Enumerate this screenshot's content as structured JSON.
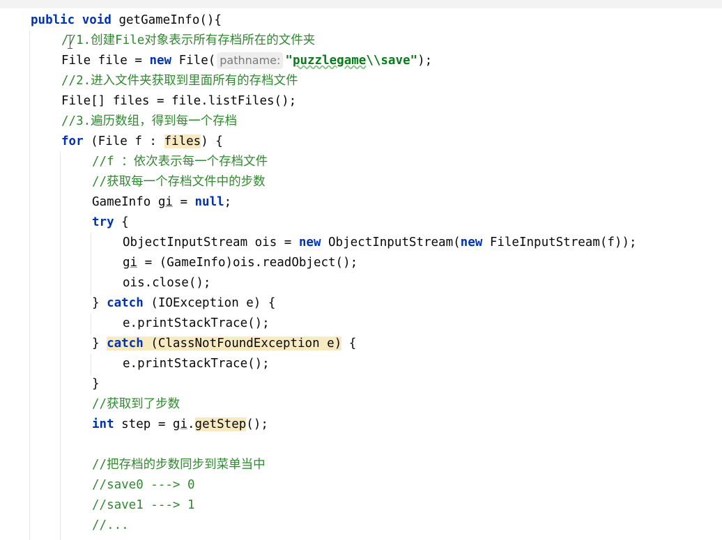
{
  "code": {
    "l1": {
      "kw1": "public",
      "kw2": "void",
      "rest": " getGameInfo(){"
    },
    "l2": {
      "comment": "//1.创建File对象表示所有存档所在的文件夹"
    },
    "l3": {
      "a": "File file = ",
      "kw": "new",
      "b": " File(",
      "hint": "pathname:",
      "str_open": "\"",
      "str_word": "puzzlegame",
      "str_rest": "\\\\save\"",
      "c": ");"
    },
    "l4": {
      "comment": "//2.进入文件夹获取到里面所有的存档文件"
    },
    "l5": {
      "text": "File[] files = file.listFiles();"
    },
    "l6": {
      "comment": "//3.遍历数组，得到每一个存档"
    },
    "l7": {
      "kw": "for",
      "a": " (File f : ",
      "hl": "files",
      "b": ") {"
    },
    "l8": {
      "comment": "//f ：依次表示每一个存档文件"
    },
    "l9": {
      "comment": "//获取每一个存档文件中的步数"
    },
    "l10": {
      "a": "GameInfo ",
      "var": "gi",
      "b": " = ",
      "kw": "null",
      "c": ";"
    },
    "l11": {
      "kw": "try",
      "a": " {"
    },
    "l12": {
      "a": "ObjectInputStream ois = ",
      "kw1": "new",
      "b": " ObjectInputStream(",
      "kw2": "new",
      "c": " FileInputStream(f));"
    },
    "l13": {
      "var": "gi",
      "a": " = (GameInfo)ois.readObject();"
    },
    "l14": {
      "text": "ois.close();"
    },
    "l15": {
      "a": "} ",
      "kw": "catch",
      "b": " (IOException e) {"
    },
    "l16": {
      "text": "e.printStackTrace();"
    },
    "l17": {
      "a": "} ",
      "kw": "catch",
      "b": " (ClassNotFoundException e)",
      "c": " {"
    },
    "l18": {
      "text": "e.printStackTrace();"
    },
    "l19": {
      "text": "}"
    },
    "l20": {
      "comment": "//获取到了步数"
    },
    "l21": {
      "kw": "int",
      "a": " step = ",
      "var": "gi",
      "b": ".",
      "hl": "getStep",
      "c": "();"
    },
    "l23": {
      "comment": "//把存档的步数同步到菜单当中"
    },
    "l24": {
      "comment": "//save0 ---> 0"
    },
    "l25": {
      "comment": "//save1 ---> 1"
    },
    "l26": {
      "comment": "//..."
    }
  }
}
